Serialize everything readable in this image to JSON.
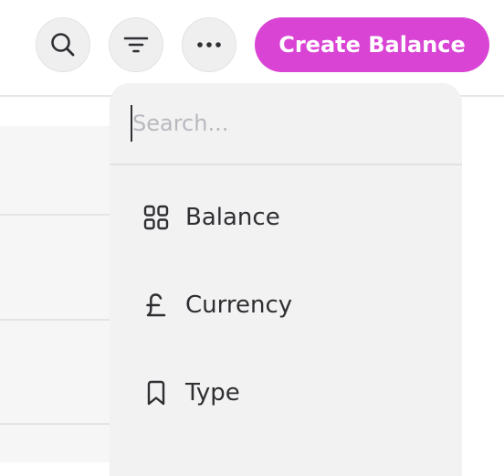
{
  "toolbar": {
    "search_icon": "search-icon",
    "filter_icon": "filter-icon",
    "more_icon": "more-horizontal-icon",
    "create_label": "Create Balance",
    "create_color": "#d944d4"
  },
  "dropdown": {
    "search_placeholder": "Search...",
    "search_value": "",
    "items": [
      {
        "label": "Balance",
        "icon": "grid-icon"
      },
      {
        "label": "Currency",
        "icon": "pound-icon"
      },
      {
        "label": "Type",
        "icon": "bookmark-icon"
      }
    ]
  }
}
